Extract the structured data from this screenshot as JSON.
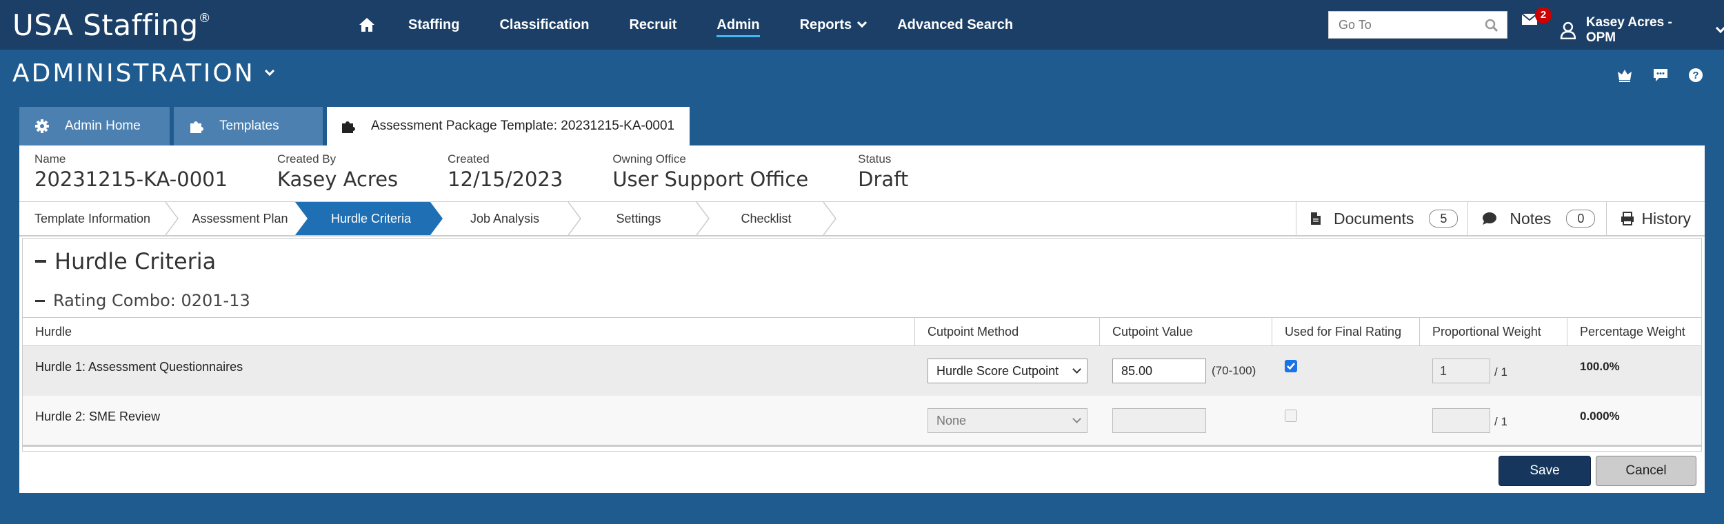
{
  "header": {
    "logo": "USA Staffing",
    "logo_mark": "®",
    "nav": [
      "Staffing",
      "Classification",
      "Recruit",
      "Admin",
      "Reports",
      "Advanced Search"
    ],
    "goto_placeholder": "Go To",
    "mail_count": "2",
    "user": "Kasey Acres - OPM"
  },
  "page_title": "ADMINISTRATION",
  "tabs": [
    "Admin Home",
    "Templates",
    "Assessment Package Template: 20231215-KA-0001"
  ],
  "info": [
    {
      "label": "Name",
      "value": "20231215-KA-0001"
    },
    {
      "label": "Created By",
      "value": "Kasey Acres"
    },
    {
      "label": "Created",
      "value": "12/15/2023"
    },
    {
      "label": "Owning Office",
      "value": "User Support Office"
    },
    {
      "label": "Status",
      "value": "Draft"
    }
  ],
  "steps": [
    "Template Information",
    "Assessment Plan",
    "Hurdle Criteria",
    "Job Analysis",
    "Settings",
    "Checklist"
  ],
  "active_step": "Hurdle Criteria",
  "side_buttons": {
    "documents": {
      "label": "Documents",
      "count": "5"
    },
    "notes": {
      "label": "Notes",
      "count": "0"
    },
    "history": {
      "label": "History"
    }
  },
  "section_title": "Hurdle Criteria",
  "subsection_title": "Rating Combo: 0201-13",
  "table": {
    "headers": [
      "Hurdle",
      "Cutpoint Method",
      "Cutpoint Value",
      "Used for Final Rating",
      "Proportional Weight",
      "Percentage Weight"
    ],
    "rows": [
      {
        "hurdle": "Hurdle 1: Assessment Questionnaires",
        "method": "Hurdle Score Cutpoint",
        "value": "85.00",
        "range": "(70-100)",
        "used": true,
        "weight": "1",
        "denominator": "/ 1",
        "percent": "100.0%"
      },
      {
        "hurdle": "Hurdle 2: SME Review",
        "method": "None",
        "value": "",
        "range": "",
        "used": false,
        "weight": "",
        "denominator": "/ 1",
        "percent": "0.000%"
      }
    ]
  },
  "buttons": {
    "save": "Save",
    "cancel": "Cancel"
  },
  "colors": {
    "topbar": "#1b3f66",
    "page_bg": "#1f5b8f",
    "tab": "#4c80b0",
    "active_step": "#1f6fb5",
    "save_button": "#17365d",
    "checkbox": "#1a73e8"
  }
}
